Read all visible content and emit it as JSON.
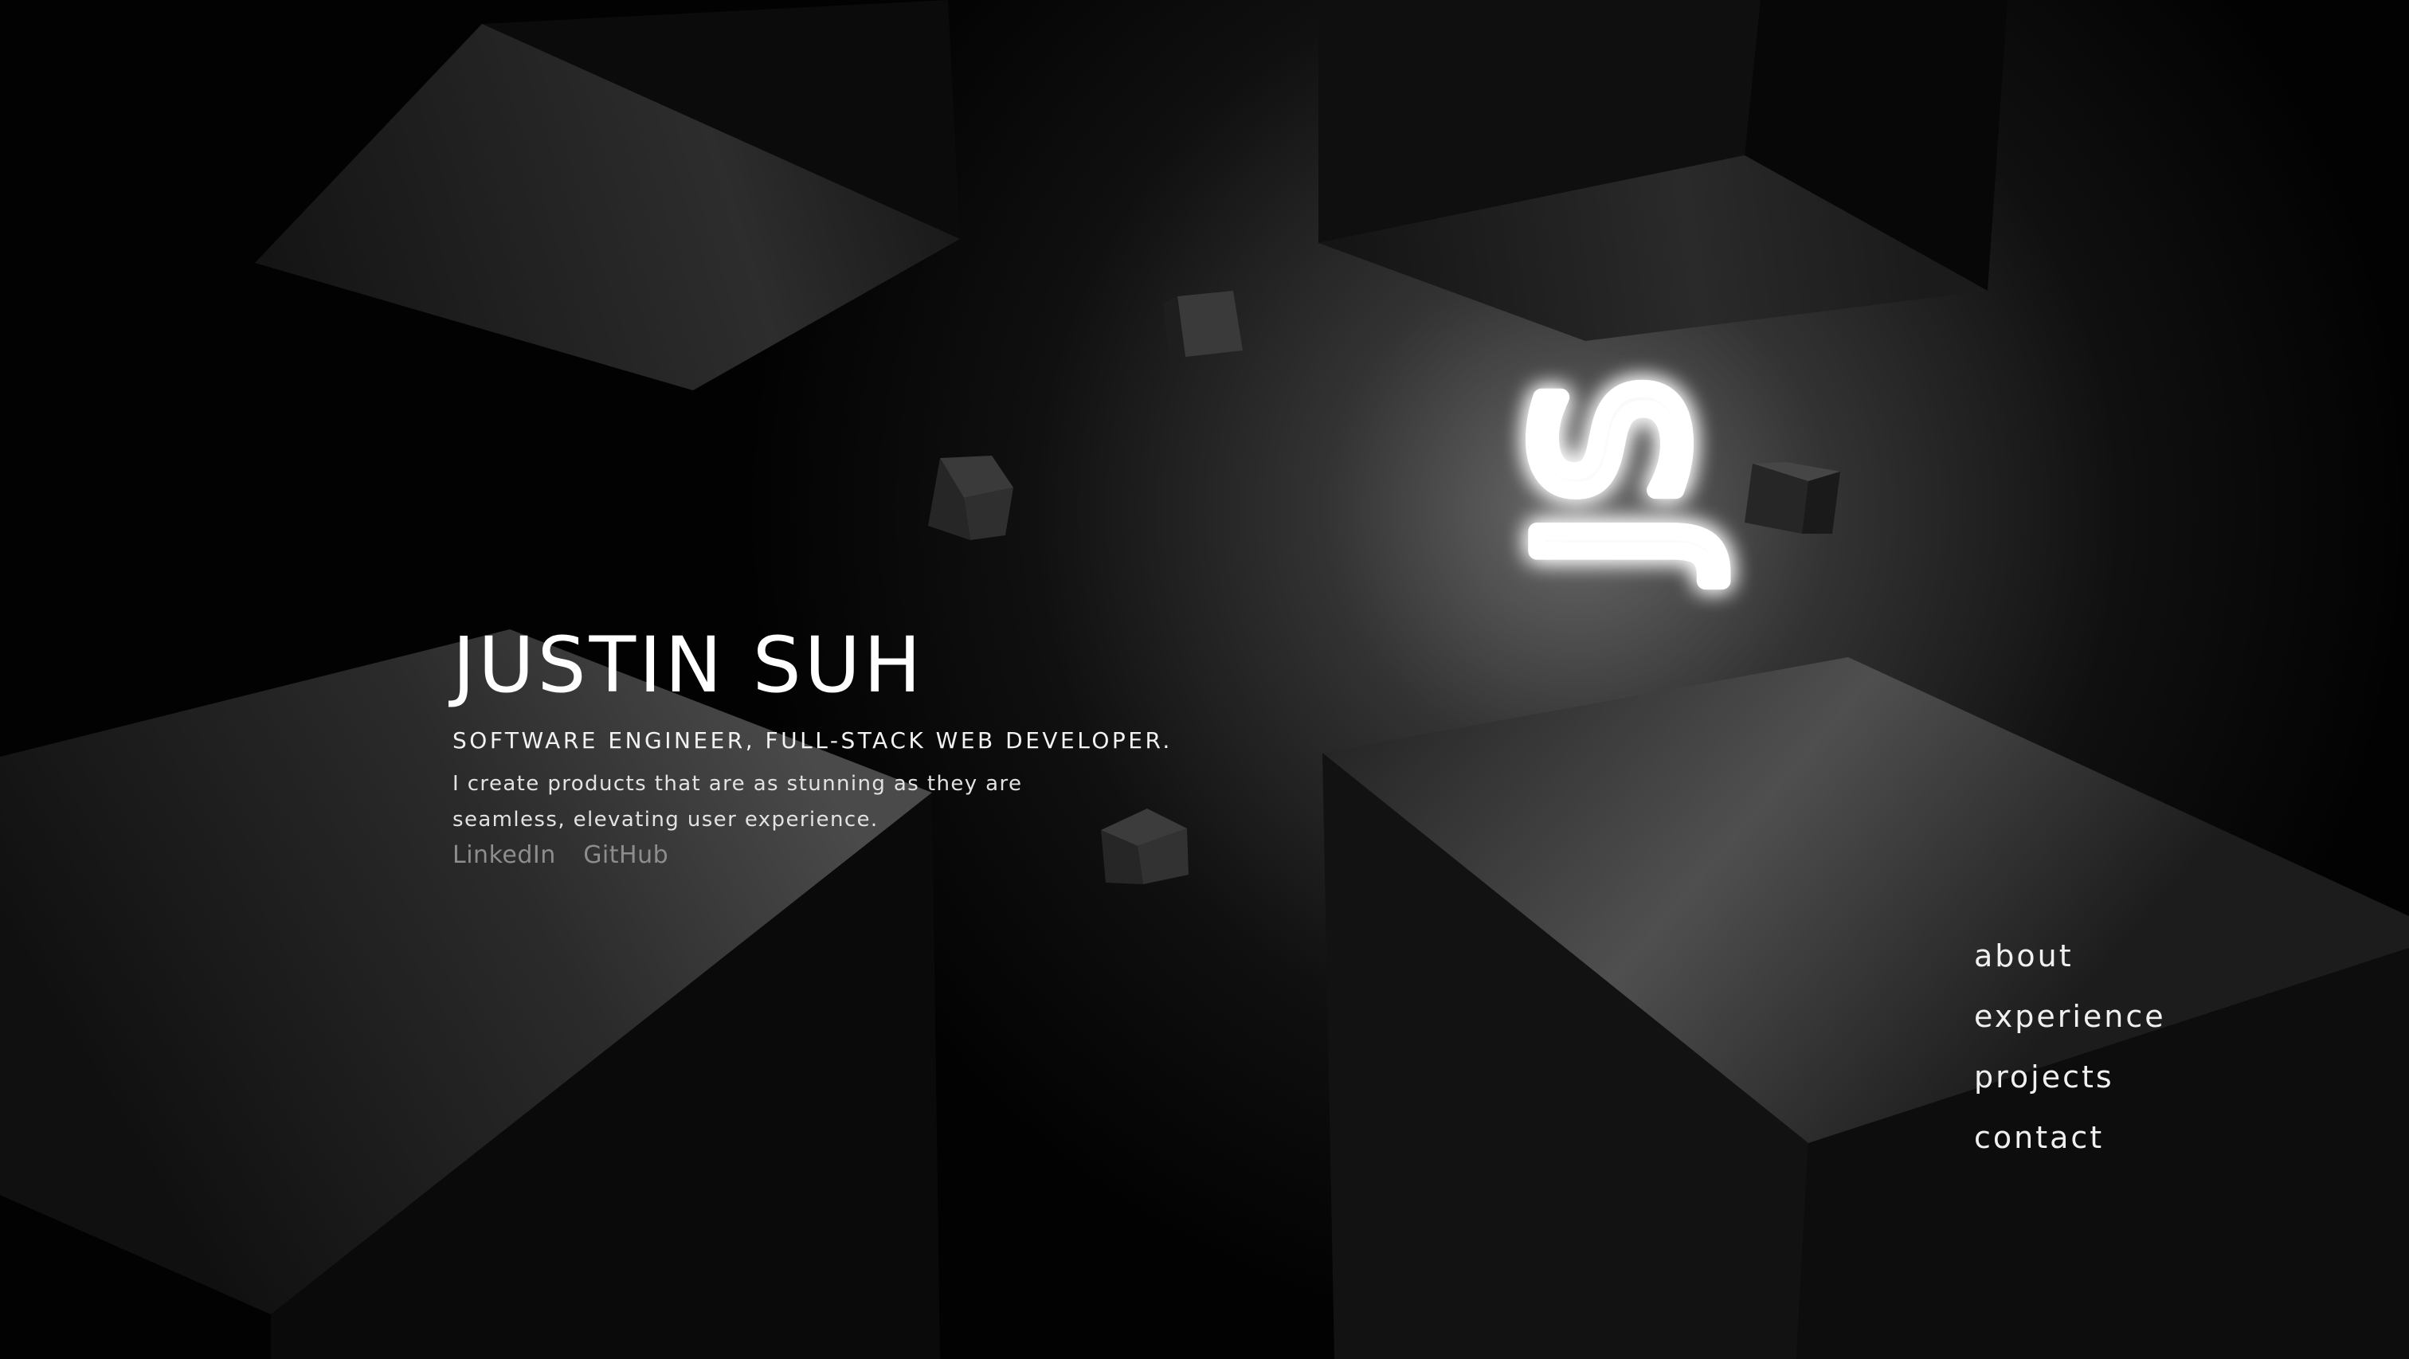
{
  "logo": "JS",
  "hero": {
    "name": "JUSTIN SUH",
    "role": "SOFTWARE ENGINEER, FULL-STACK WEB DEVELOPER.",
    "description": "I create products that are as stunning as they are seamless, elevating user experience.",
    "links": [
      "LinkedIn",
      "GitHub"
    ]
  },
  "nav": {
    "items": [
      "about",
      "experience",
      "projects",
      "contact"
    ]
  },
  "colors": {
    "background": "#020202",
    "text": "#ffffff",
    "muted_link": "#8d8d8d",
    "logo_glow": "#ffffff"
  }
}
